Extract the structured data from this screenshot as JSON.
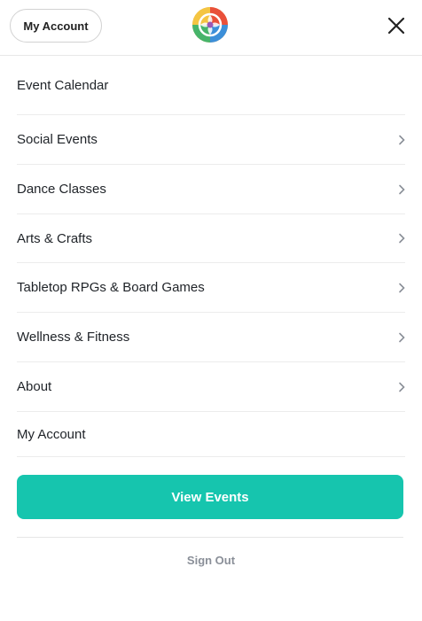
{
  "header": {
    "account_label": "My Account",
    "logo_icon": "rainbow-flower-logo-icon",
    "close_icon": "close-x-icon"
  },
  "menu": {
    "items": [
      {
        "label": "Event Calendar",
        "has_chevron": false
      },
      {
        "label": "Social Events",
        "has_chevron": true
      },
      {
        "label": "Dance Classes",
        "has_chevron": true
      },
      {
        "label": "Arts & Crafts",
        "has_chevron": true
      },
      {
        "label": "Tabletop RPGs & Board Games",
        "has_chevron": true
      },
      {
        "label": "Wellness & Fitness",
        "has_chevron": true
      },
      {
        "label": "About",
        "has_chevron": true
      },
      {
        "label": "My Account",
        "has_chevron": false
      }
    ]
  },
  "cta": {
    "label": "View Events",
    "color": "#16c5ae"
  },
  "footer": {
    "signout_label": "Sign Out"
  }
}
